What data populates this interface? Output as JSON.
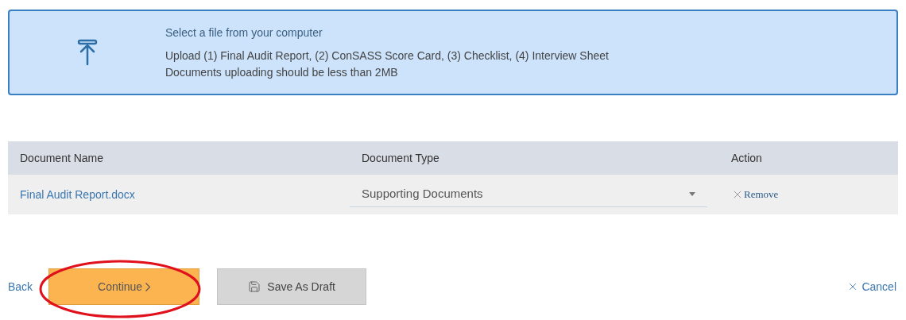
{
  "upload": {
    "title": "Select a file from your computer",
    "lines": [
      "Upload (1) Final Audit Report, (2) ConSASS Score Card, (3) Checklist, (4) Interview Sheet",
      "Documents uploading should be less than 2MB"
    ]
  },
  "table": {
    "columns": [
      "Document Name",
      "Document Type",
      "Action"
    ],
    "rows": [
      {
        "name": "Final Audit Report.docx",
        "type": "Supporting Documents",
        "action": "Remove"
      }
    ]
  },
  "footer": {
    "back": "Back",
    "continue": "Continue",
    "save": "Save As Draft",
    "cancel": "Cancel",
    "continue_highlighted": true
  }
}
